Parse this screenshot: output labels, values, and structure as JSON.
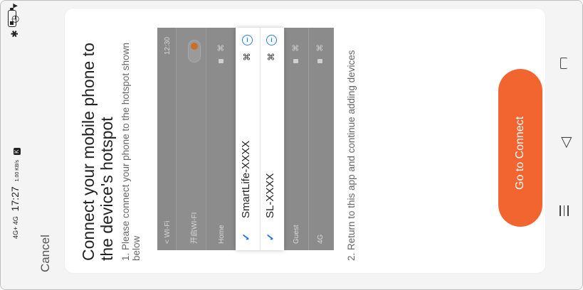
{
  "status_bar": {
    "signal": "4G+ 4G",
    "time": "17:27",
    "speed": "1.00 KB/s",
    "notification": "K",
    "right_icons": "✱ ◷ ▾"
  },
  "cancel_label": "Cancel",
  "heading": "Connect your mobile phone to the device's hotspot",
  "step1": "1. Please connect your phone to the hotspot shown below",
  "step2": "2. Return to this app and continue adding devices",
  "illustration": {
    "back_label": "< WI-Fi",
    "time": "12:30",
    "wifi_toggle_label": "开启WI-FI",
    "networks_gray_top": [
      "Home"
    ],
    "networks_highlight": [
      "SmartLife-XXXX",
      "SL-XXXX"
    ],
    "networks_gray_bottom": [
      "Guest",
      "4G"
    ]
  },
  "go_button_label": "Go to Connect",
  "colors": {
    "accent": "#f26430",
    "check": "#1a73e8"
  },
  "nav_icons": [
    "menu-icon",
    "back-icon",
    "home-icon"
  ]
}
